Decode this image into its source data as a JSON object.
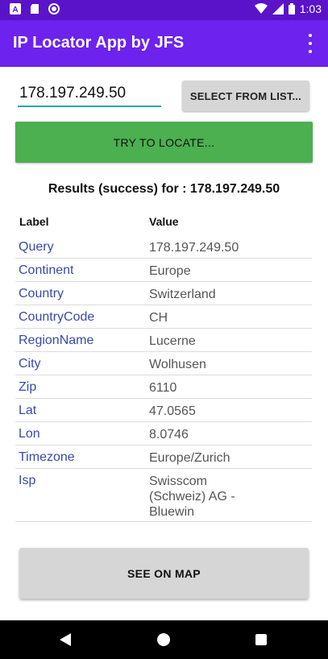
{
  "status_bar": {
    "time": "1:03",
    "icons": [
      "keyboard-a-icon",
      "sd-card-icon",
      "record-icon",
      "wifi-icon",
      "signal-icon",
      "battery-icon"
    ]
  },
  "app_bar": {
    "title": "IP Locator App by JFS",
    "menu_icon": "more-vert-icon"
  },
  "form": {
    "ip_value": "178.197.249.50",
    "select_button": "SELECT FROM LIST...",
    "locate_button": "TRY TO LOCATE..."
  },
  "results": {
    "title": "Results (success) for : 178.197.249.50",
    "header_label": "Label",
    "header_value": "Value",
    "rows": [
      {
        "label": "Query",
        "value": "178.197.249.50"
      },
      {
        "label": "Continent",
        "value": "Europe"
      },
      {
        "label": "Country",
        "value": "Switzerland"
      },
      {
        "label": "CountryCode",
        "value": "CH"
      },
      {
        "label": "RegionName",
        "value": "Lucerne"
      },
      {
        "label": "City",
        "value": "Wolhusen"
      },
      {
        "label": "Zip",
        "value": "6110"
      },
      {
        "label": "Lat",
        "value": "47.0565"
      },
      {
        "label": "Lon",
        "value": "8.0746"
      },
      {
        "label": "Timezone",
        "value": "Europe/Zurich"
      },
      {
        "label": "Isp",
        "value": "Swisscom (Schweiz) AG - Bluewin"
      }
    ]
  },
  "map_button": "SEE ON MAP",
  "colors": {
    "status_bar": "#5a13c9",
    "app_bar": "#6d22ee",
    "locate_button": "#4caf50",
    "label_text": "#3949ab",
    "input_underline": "#2aa7a7"
  }
}
